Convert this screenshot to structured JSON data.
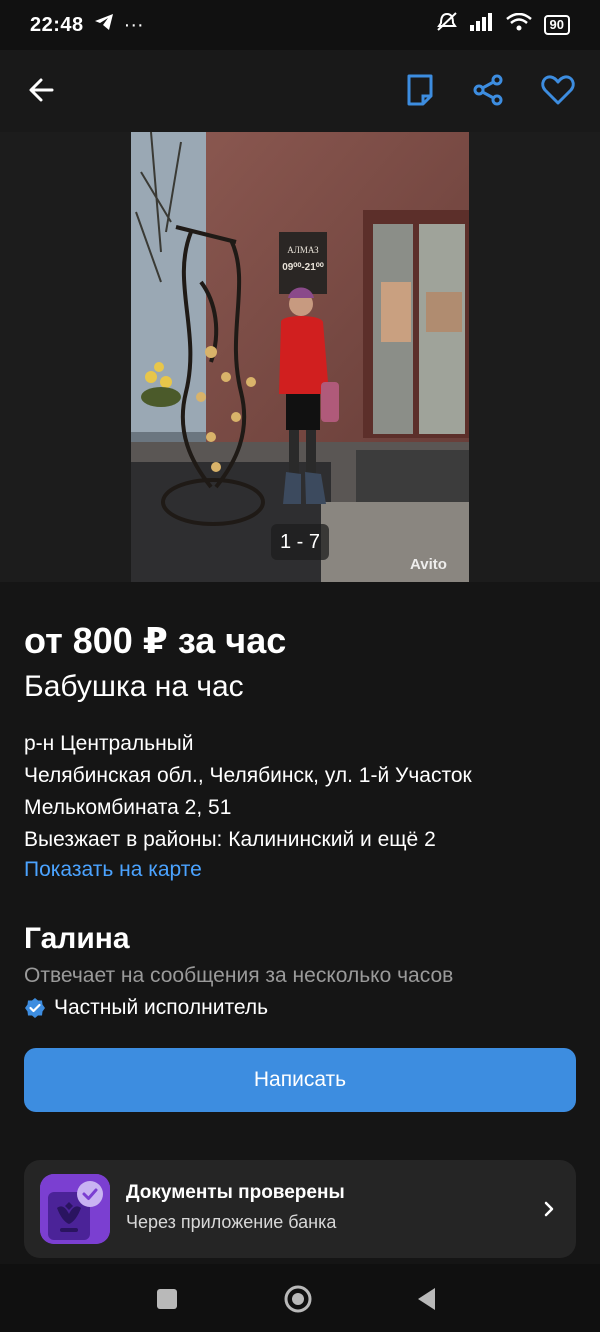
{
  "status": {
    "time": "22:48",
    "battery": "90"
  },
  "listing": {
    "price": "от 800 ₽ за час",
    "title": "Бабушка на час",
    "district": "р-н Центральный",
    "address_line1": "Челябинская обл., Челябинск, ул. 1-й Участок",
    "address_line2": "Мелькомбината 2, 51",
    "areas": "Выезжает в районы: Калининский и ещё 2",
    "map_link": "Показать на карте"
  },
  "photo": {
    "counter": "1 - 7",
    "watermark": "Avito",
    "sign_line1": "АЛМАЗ",
    "sign_line2": "09⁰⁰-21⁰⁰"
  },
  "seller": {
    "name": "Галина",
    "response": "Отвечает на сообщения за несколько часов",
    "type": "Частный исполнитель"
  },
  "actions": {
    "write": "Написать"
  },
  "docs": {
    "title": "Документы проверены",
    "subtitle": "Через приложение банка"
  },
  "colors": {
    "accent": "#3d8de0",
    "link": "#4ba3ff",
    "docs_icon": "#7b3fd1"
  }
}
